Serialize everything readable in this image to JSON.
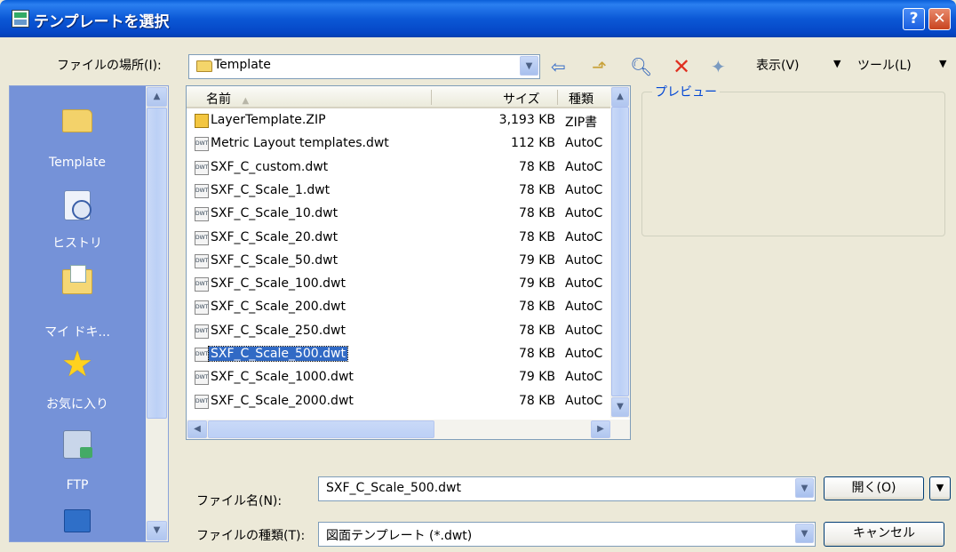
{
  "window": {
    "title": "テンプレートを選択",
    "help_label": "?",
    "close_label": "✕"
  },
  "toolbar": {
    "location_label": "ファイルの場所(I):",
    "location_value": "Template",
    "view_label": "表示(V)",
    "tools_label": "ツール(L)",
    "icons": [
      "back-icon",
      "up-folder-icon",
      "search-web-icon",
      "delete-icon",
      "new-folder-icon"
    ]
  },
  "places": [
    {
      "label": "Template",
      "icon": "folder-icon"
    },
    {
      "label": "ヒストリ",
      "icon": "history-icon"
    },
    {
      "label": "マイ ドキ...",
      "icon": "my-documents-icon"
    },
    {
      "label": "お気に入り",
      "icon": "favorites-icon"
    },
    {
      "label": "FTP",
      "icon": "ftp-icon"
    },
    {
      "label": "",
      "icon": "desktop-icon"
    }
  ],
  "filelist": {
    "columns": {
      "name": "名前",
      "size": "サイズ",
      "type": "種類"
    },
    "rows": [
      {
        "name": "LayerTemplate.ZIP",
        "size": "3,193 KB",
        "type": "ZIP書",
        "icon": "zip-icon"
      },
      {
        "name": "Metric Layout templates.dwt",
        "size": "112 KB",
        "type": "AutoC",
        "icon": "dwt-icon"
      },
      {
        "name": "SXF_C_custom.dwt",
        "size": "78 KB",
        "type": "AutoC",
        "icon": "dwt-icon"
      },
      {
        "name": "SXF_C_Scale_1.dwt",
        "size": "78 KB",
        "type": "AutoC",
        "icon": "dwt-icon"
      },
      {
        "name": "SXF_C_Scale_10.dwt",
        "size": "78 KB",
        "type": "AutoC",
        "icon": "dwt-icon"
      },
      {
        "name": "SXF_C_Scale_20.dwt",
        "size": "78 KB",
        "type": "AutoC",
        "icon": "dwt-icon"
      },
      {
        "name": "SXF_C_Scale_50.dwt",
        "size": "79 KB",
        "type": "AutoC",
        "icon": "dwt-icon"
      },
      {
        "name": "SXF_C_Scale_100.dwt",
        "size": "79 KB",
        "type": "AutoC",
        "icon": "dwt-icon"
      },
      {
        "name": "SXF_C_Scale_200.dwt",
        "size": "78 KB",
        "type": "AutoC",
        "icon": "dwt-icon"
      },
      {
        "name": "SXF_C_Scale_250.dwt",
        "size": "78 KB",
        "type": "AutoC",
        "icon": "dwt-icon"
      },
      {
        "name": "SXF_C_Scale_500.dwt",
        "size": "78 KB",
        "type": "AutoC",
        "icon": "dwt-icon",
        "selected": true
      },
      {
        "name": "SXF_C_Scale_1000.dwt",
        "size": "79 KB",
        "type": "AutoC",
        "icon": "dwt-icon"
      },
      {
        "name": "SXF_C_Scale_2000.dwt",
        "size": "78 KB",
        "type": "AutoC",
        "icon": "dwt-icon"
      }
    ]
  },
  "preview": {
    "label": "プレビュー"
  },
  "bottom": {
    "filename_label": "ファイル名(N):",
    "filename_value": "SXF_C_Scale_500.dwt",
    "filetype_label": "ファイルの種類(T):",
    "filetype_value": "図面テンプレート (*.dwt)",
    "open_label": "開く(O)",
    "cancel_label": "キャンセル"
  }
}
